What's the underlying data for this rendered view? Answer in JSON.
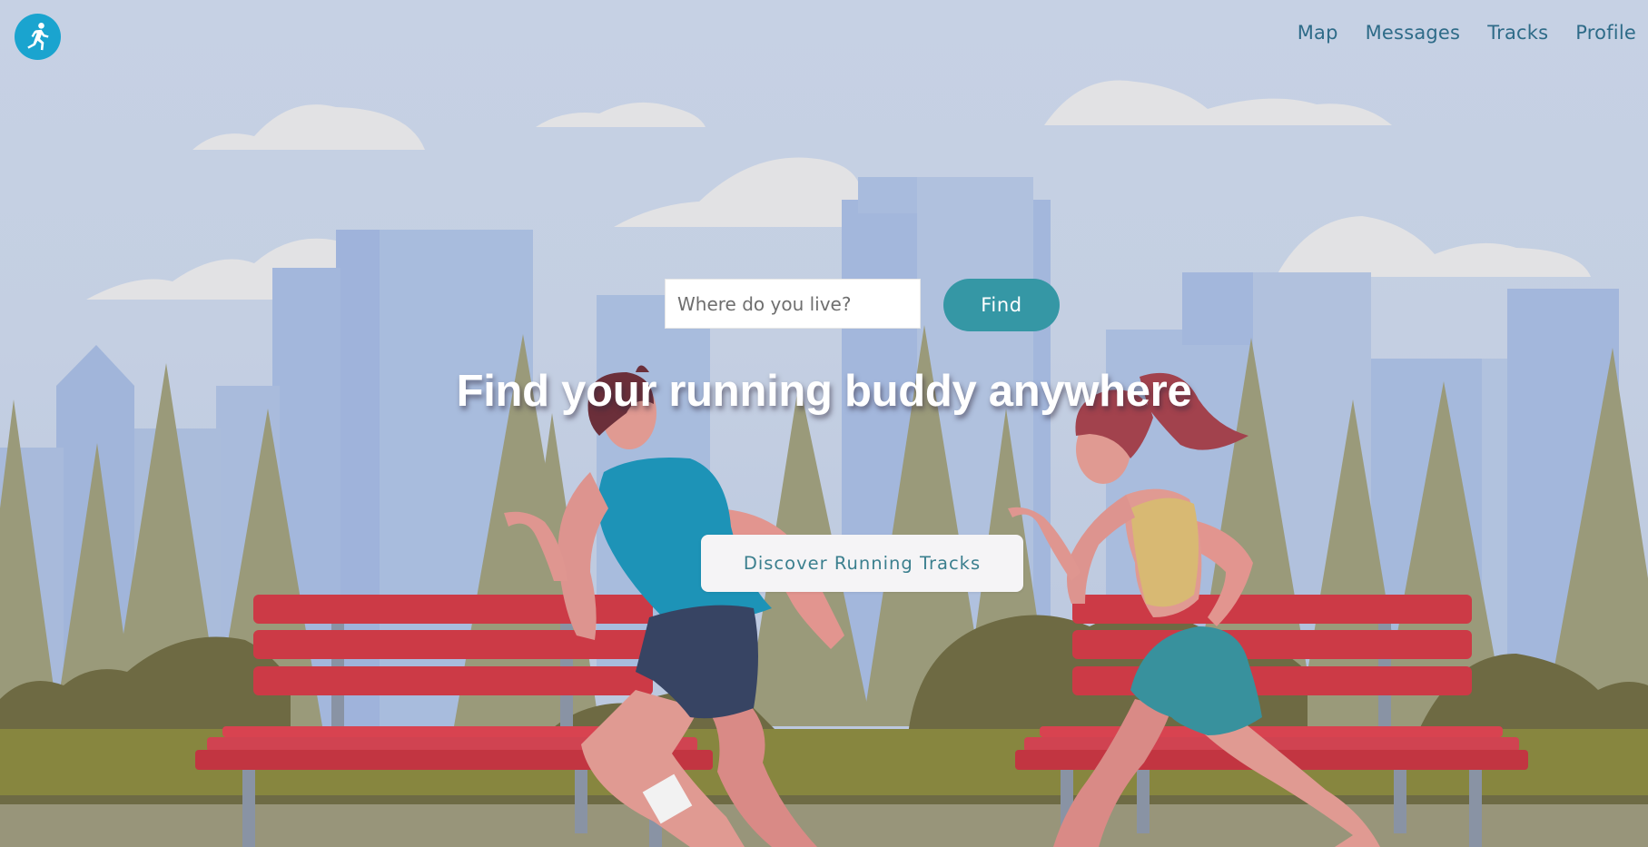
{
  "header": {
    "logo_icon": "running-person-icon",
    "nav": [
      {
        "label": "Map"
      },
      {
        "label": "Messages"
      },
      {
        "label": "Tracks"
      },
      {
        "label": "Profile"
      }
    ]
  },
  "hero": {
    "search": {
      "placeholder": "Where do you live?",
      "value": ""
    },
    "find_label": "Find",
    "headline": "Find your running buddy anywhere",
    "discover_label": "Discover Running Tracks"
  },
  "colors": {
    "sky": "#c6d1e4",
    "accent": "#3597a5",
    "logo": "#1aa4cf",
    "nav_text": "#2e6b88",
    "bench": "#c93a45"
  }
}
